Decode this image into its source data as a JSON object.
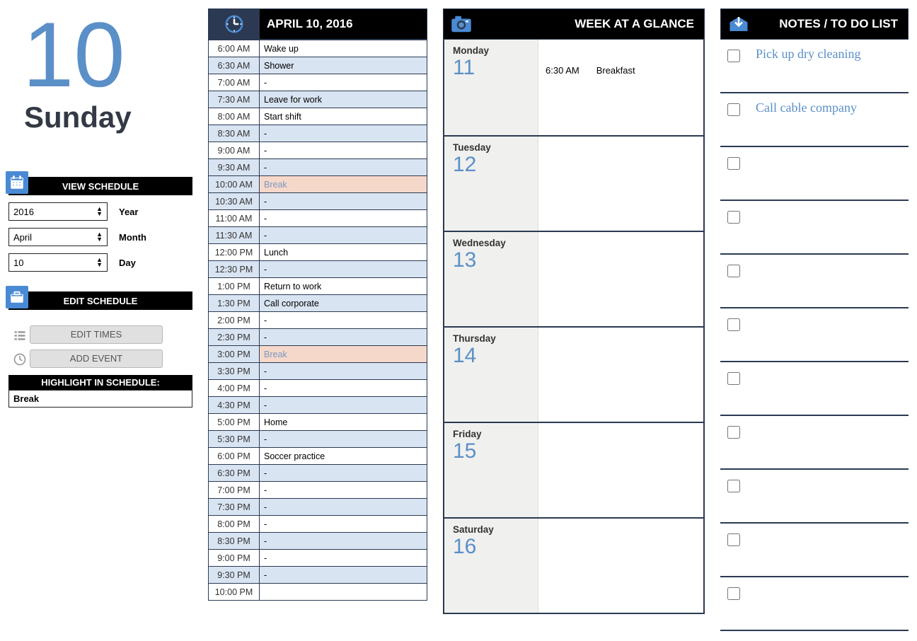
{
  "day_number": "10",
  "weekday": "Sunday",
  "view_schedule_label": "VIEW SCHEDULE",
  "year_value": "2016",
  "year_label": "Year",
  "month_value": "April",
  "month_label": "Month",
  "day_value": "10",
  "day_label": "Day",
  "edit_schedule_label": "EDIT SCHEDULE",
  "edit_times_btn": "EDIT TIMES",
  "add_event_btn": "ADD EVENT",
  "highlight_head": "HIGHLIGHT IN SCHEDULE:",
  "highlight_value": "Break",
  "schedule_date": "APRIL 10, 2016",
  "schedule": [
    {
      "time": "6:00 AM",
      "event": "Wake up",
      "shade": false,
      "hl": false
    },
    {
      "time": "6:30 AM",
      "event": "Shower",
      "shade": true,
      "hl": false
    },
    {
      "time": "7:00 AM",
      "event": "-",
      "shade": false,
      "hl": false
    },
    {
      "time": "7:30 AM",
      "event": "Leave for work",
      "shade": true,
      "hl": false
    },
    {
      "time": "8:00 AM",
      "event": "Start shift",
      "shade": false,
      "hl": false
    },
    {
      "time": "8:30 AM",
      "event": "-",
      "shade": true,
      "hl": false
    },
    {
      "time": "9:00 AM",
      "event": "-",
      "shade": false,
      "hl": false
    },
    {
      "time": "9:30 AM",
      "event": "-",
      "shade": true,
      "hl": false
    },
    {
      "time": "10:00 AM",
      "event": "Break",
      "shade": false,
      "hl": true
    },
    {
      "time": "10:30 AM",
      "event": "-",
      "shade": true,
      "hl": false
    },
    {
      "time": "11:00 AM",
      "event": "-",
      "shade": false,
      "hl": false
    },
    {
      "time": "11:30 AM",
      "event": "-",
      "shade": true,
      "hl": false
    },
    {
      "time": "12:00 PM",
      "event": "Lunch",
      "shade": false,
      "hl": false
    },
    {
      "time": "12:30 PM",
      "event": "-",
      "shade": true,
      "hl": false
    },
    {
      "time": "1:00 PM",
      "event": "Return to work",
      "shade": false,
      "hl": false
    },
    {
      "time": "1:30 PM",
      "event": "Call corporate",
      "shade": true,
      "hl": false
    },
    {
      "time": "2:00 PM",
      "event": "-",
      "shade": false,
      "hl": false
    },
    {
      "time": "2:30 PM",
      "event": "-",
      "shade": true,
      "hl": false
    },
    {
      "time": "3:00 PM",
      "event": "Break",
      "shade": false,
      "hl": true
    },
    {
      "time": "3:30 PM",
      "event": "-",
      "shade": true,
      "hl": false
    },
    {
      "time": "4:00 PM",
      "event": "-",
      "shade": false,
      "hl": false
    },
    {
      "time": "4:30 PM",
      "event": "-",
      "shade": true,
      "hl": false
    },
    {
      "time": "5:00 PM",
      "event": "Home",
      "shade": false,
      "hl": false
    },
    {
      "time": "5:30 PM",
      "event": "-",
      "shade": true,
      "hl": false
    },
    {
      "time": "6:00 PM",
      "event": "Soccer practice",
      "shade": false,
      "hl": false
    },
    {
      "time": "6:30 PM",
      "event": "-",
      "shade": true,
      "hl": false
    },
    {
      "time": "7:00 PM",
      "event": "-",
      "shade": false,
      "hl": false
    },
    {
      "time": "7:30 PM",
      "event": "-",
      "shade": true,
      "hl": false
    },
    {
      "time": "8:00 PM",
      "event": "-",
      "shade": false,
      "hl": false
    },
    {
      "time": "8:30 PM",
      "event": "-",
      "shade": true,
      "hl": false
    },
    {
      "time": "9:00 PM",
      "event": "-",
      "shade": false,
      "hl": false
    },
    {
      "time": "9:30 PM",
      "event": "-",
      "shade": true,
      "hl": false
    },
    {
      "time": "10:00 PM",
      "event": "",
      "shade": false,
      "hl": false
    }
  ],
  "week_title": "WEEK AT A GLANCE",
  "week": [
    {
      "name": "Monday",
      "num": "11",
      "ev_time": "6:30 AM",
      "ev_text": "Breakfast"
    },
    {
      "name": "Tuesday",
      "num": "12",
      "ev_time": "",
      "ev_text": ""
    },
    {
      "name": "Wednesday",
      "num": "13",
      "ev_time": "",
      "ev_text": ""
    },
    {
      "name": "Thursday",
      "num": "14",
      "ev_time": "",
      "ev_text": ""
    },
    {
      "name": "Friday",
      "num": "15",
      "ev_time": "",
      "ev_text": ""
    },
    {
      "name": "Saturday",
      "num": "16",
      "ev_time": "",
      "ev_text": ""
    }
  ],
  "notes_title": "NOTES / TO DO LIST",
  "notes": [
    "Pick up dry cleaning",
    "Call cable company",
    "",
    "",
    "",
    "",
    "",
    "",
    "",
    "",
    ""
  ]
}
